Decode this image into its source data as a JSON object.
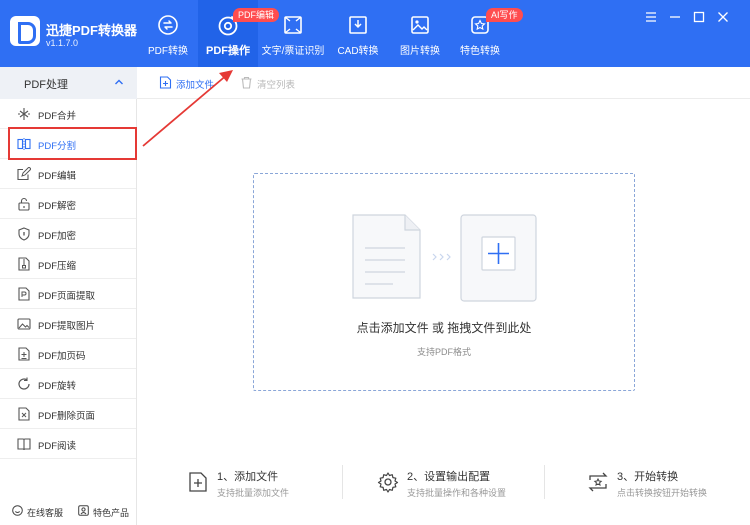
{
  "app": {
    "name": "迅捷PDF转换器",
    "version": "v1.1.7.0"
  },
  "nav": {
    "tabs": [
      {
        "label": "PDF转换",
        "icon": "pdf-convert-icon"
      },
      {
        "label": "PDF操作",
        "icon": "pdf-operate-icon",
        "badge": "PDF编辑",
        "active": true
      },
      {
        "label": "文字/票证识别",
        "icon": "ocr-icon"
      },
      {
        "label": "CAD转换",
        "icon": "cad-icon"
      },
      {
        "label": "图片转换",
        "icon": "image-icon"
      },
      {
        "label": "特色转换",
        "icon": "special-icon",
        "badge": "AI写作"
      }
    ]
  },
  "window": {
    "controls": [
      "menu",
      "minimize",
      "maximize",
      "close"
    ]
  },
  "sidebar": {
    "header": "PDF处理",
    "items": [
      {
        "label": "PDF合并",
        "icon": "merge-icon"
      },
      {
        "label": "PDF分割",
        "icon": "split-icon",
        "active": true
      },
      {
        "label": "PDF编辑",
        "icon": "edit-icon"
      },
      {
        "label": "PDF解密",
        "icon": "unlock-icon"
      },
      {
        "label": "PDF加密",
        "icon": "shield-icon"
      },
      {
        "label": "PDF压缩",
        "icon": "compress-icon"
      },
      {
        "label": "PDF页面提取",
        "icon": "page-extract-icon"
      },
      {
        "label": "PDF提取图片",
        "icon": "image-extract-icon"
      },
      {
        "label": "PDF加页码",
        "icon": "page-number-icon"
      },
      {
        "label": "PDF旋转",
        "icon": "rotate-icon"
      },
      {
        "label": "PDF删除页面",
        "icon": "delete-page-icon"
      },
      {
        "label": "PDF阅读",
        "icon": "book-icon"
      }
    ],
    "footer": {
      "service": "在线客服",
      "products": "特色产品"
    }
  },
  "toolbar": {
    "add_file": "添加文件",
    "clear_list": "清空列表"
  },
  "dropzone": {
    "title": "点击添加文件 或 拖拽文件到此处",
    "subtitle": "支持PDF格式"
  },
  "steps": [
    {
      "title": "1、添加文件",
      "desc": "支持批量添加文件"
    },
    {
      "title": "2、设置输出配置",
      "desc": "支持批量操作和各种设置"
    },
    {
      "title": "3、开始转换",
      "desc": "点击转换按钮开始转换"
    }
  ],
  "colors": {
    "primary": "#2f6ff3",
    "annotation": "#e53935",
    "badge": "#ff4d4f"
  }
}
